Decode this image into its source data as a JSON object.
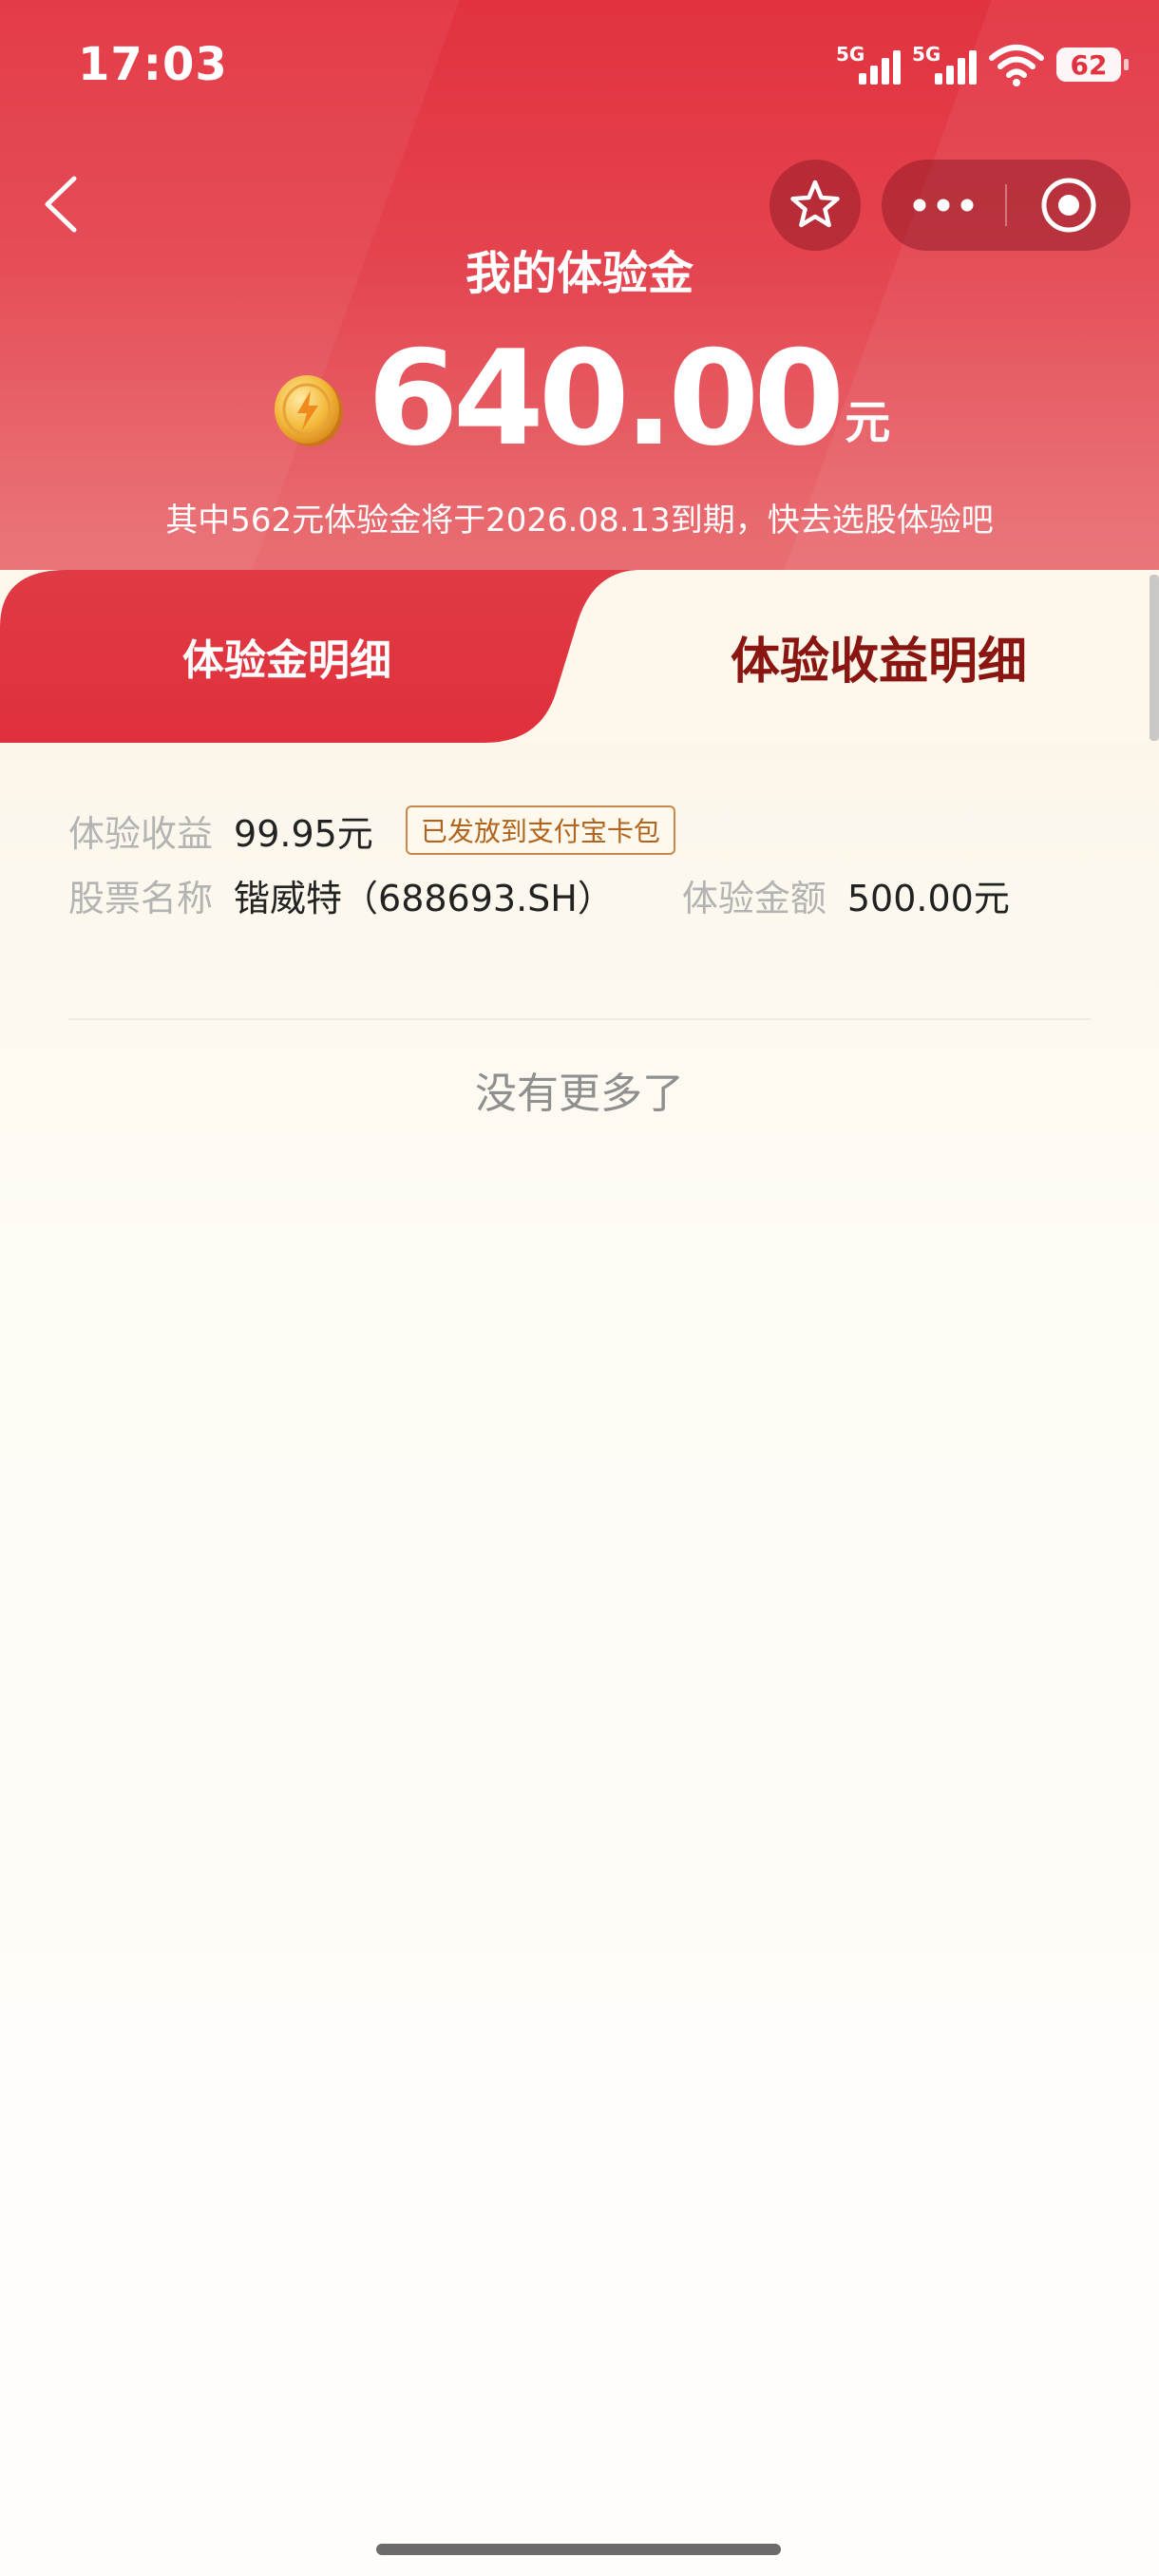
{
  "status_bar": {
    "time": "17:03",
    "signal1_label": "5G",
    "signal2_label": "5G",
    "battery": "62"
  },
  "nav": {
    "back_icon": "chevron-left-icon",
    "favorite_icon": "star-icon",
    "more_icon": "more-dots-icon",
    "close_icon": "target-circle-icon"
  },
  "header": {
    "title": "我的体验金",
    "balance_amount": "640.00",
    "balance_unit": "元",
    "expiry_note": "其中562元体验金将于2026.08.13到期，快去选股体验吧",
    "coin_icon": "lightning-coin-icon"
  },
  "tabs": [
    {
      "label": "体验金明细",
      "active": false
    },
    {
      "label": "体验收益明细",
      "active": true
    }
  ],
  "record": {
    "income_label": "体验收益",
    "income_value": "99.95元",
    "status_badge": "已发放到支付宝卡包",
    "stock_label": "股票名称",
    "stock_value": "锴威特（688693.SH）",
    "amount_label": "体验金额",
    "amount_value": "500.00元"
  },
  "footer": {
    "no_more": "没有更多了"
  },
  "colors": {
    "primary_red": "#e2323f",
    "active_tab_text": "#8a1612",
    "badge_border": "#c9884a",
    "badge_text": "#b0641e",
    "label_gray": "#b3b3b3"
  }
}
